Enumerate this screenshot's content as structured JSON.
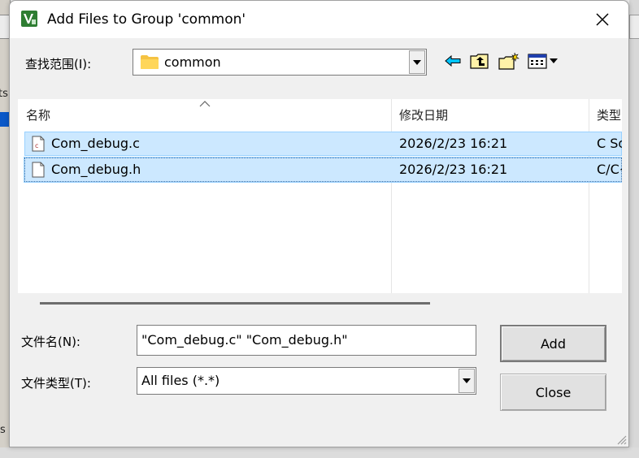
{
  "dialog": {
    "title": "Add Files to Group 'common'",
    "close_icon": "close-icon"
  },
  "lookin": {
    "label": "查找范围(I):",
    "value": "common"
  },
  "toolbar": {
    "back_icon": "back-arrow-icon",
    "up_icon": "up-folder-icon",
    "new_folder_icon": "new-folder-icon",
    "view_icon": "view-menu-icon"
  },
  "columns": {
    "name": "名称",
    "date": "修改日期",
    "type": "类型"
  },
  "files": [
    {
      "name": "Com_debug.c",
      "date": "2026/2/23 16:21",
      "type": "C Source file"
    },
    {
      "name": "Com_debug.h",
      "date": "2026/2/23 16:21",
      "type": "C/C++ Header"
    }
  ],
  "filename": {
    "label": "文件名(N):",
    "value": "\"Com_debug.c\" \"Com_debug.h\""
  },
  "filetype": {
    "label": "文件类型(T):",
    "value": "All files (*.*)"
  },
  "buttons": {
    "add": "Add",
    "close": "Close"
  },
  "background": {
    "frag1": "ts",
    "frag2": "s"
  }
}
